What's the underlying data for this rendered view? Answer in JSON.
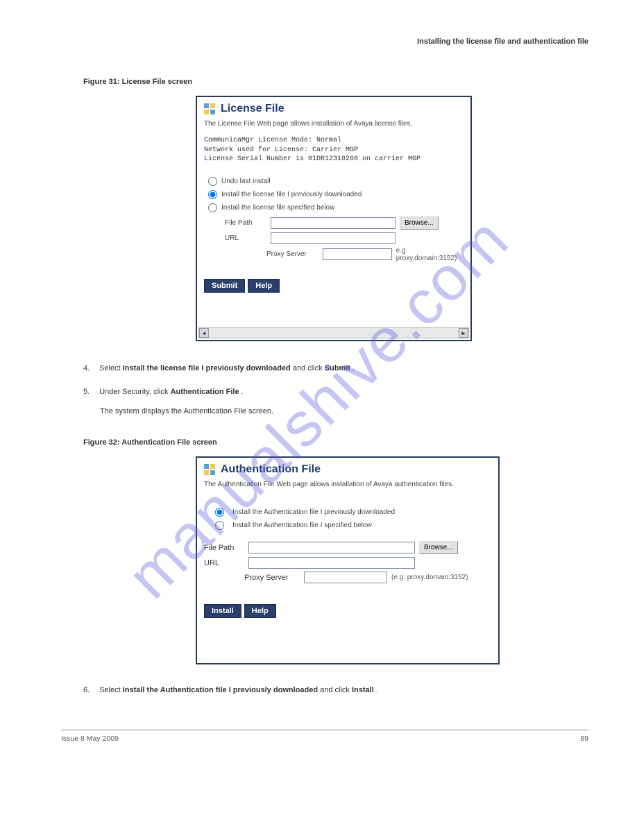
{
  "watermark": "manualshive.com",
  "chapter_mark": "Installing the license file and authentication file",
  "figure1_caption": "Figure 31: License File screen",
  "panel1": {
    "title": "License File",
    "desc": "The License File Web page allows installation of Avaya license files.",
    "mono": "CommunicaMgr License Mode: Normal\nNetwork used for License: Carrier MGP\nLicense Serial Number is 01DR12310260 on carrier MGP",
    "opt_undo": "Undo last install",
    "opt_prev": "Install the license file I previously downloaded",
    "opt_spec": "Install the license file specified below",
    "lbl_filepath": "File Path",
    "lbl_url": "URL",
    "lbl_proxy": "Proxy Server",
    "btn_browse": "Browse...",
    "hint_proxy": "e.g proxy.domain:3152)",
    "btn_submit": "Submit",
    "btn_help": "Help"
  },
  "step4": {
    "num": "4.",
    "text_a": "Select ",
    "text_bold": "Install the license file I previously downloaded",
    "text_b": " and click ",
    "text_bold2": "Submit",
    "text_c": "."
  },
  "step5": {
    "num": "5.",
    "text_a": "Under Security, click ",
    "text_bold": "Authentication File",
    "text_b": "."
  },
  "step5b": "The system displays the Authentication File screen.",
  "figure2_caption": "Figure 32: Authentication File screen",
  "panel2": {
    "title": "Authentication File",
    "desc": "The Authentication File Web page allows installation of Avaya authentication files.",
    "opt_prev": "Install the Authentication file I previously downloaded",
    "opt_spec": "Install the Authentication file I specified below",
    "lbl_filepath": "File Path",
    "lbl_url": "URL",
    "lbl_proxy": "Proxy Server",
    "btn_browse": "Browse...",
    "hint_proxy": "(e.g. proxy.domain:3152)",
    "btn_install": "Install",
    "btn_help": "Help"
  },
  "step6": {
    "num": "6.",
    "text_a": "Select ",
    "text_bold": "Install the Authentication file I previously downloaded",
    "text_b": " and click ",
    "text_bold2": "Install",
    "text_c": "."
  },
  "footer": {
    "left": "Issue 8 May 2009",
    "right": "89"
  }
}
